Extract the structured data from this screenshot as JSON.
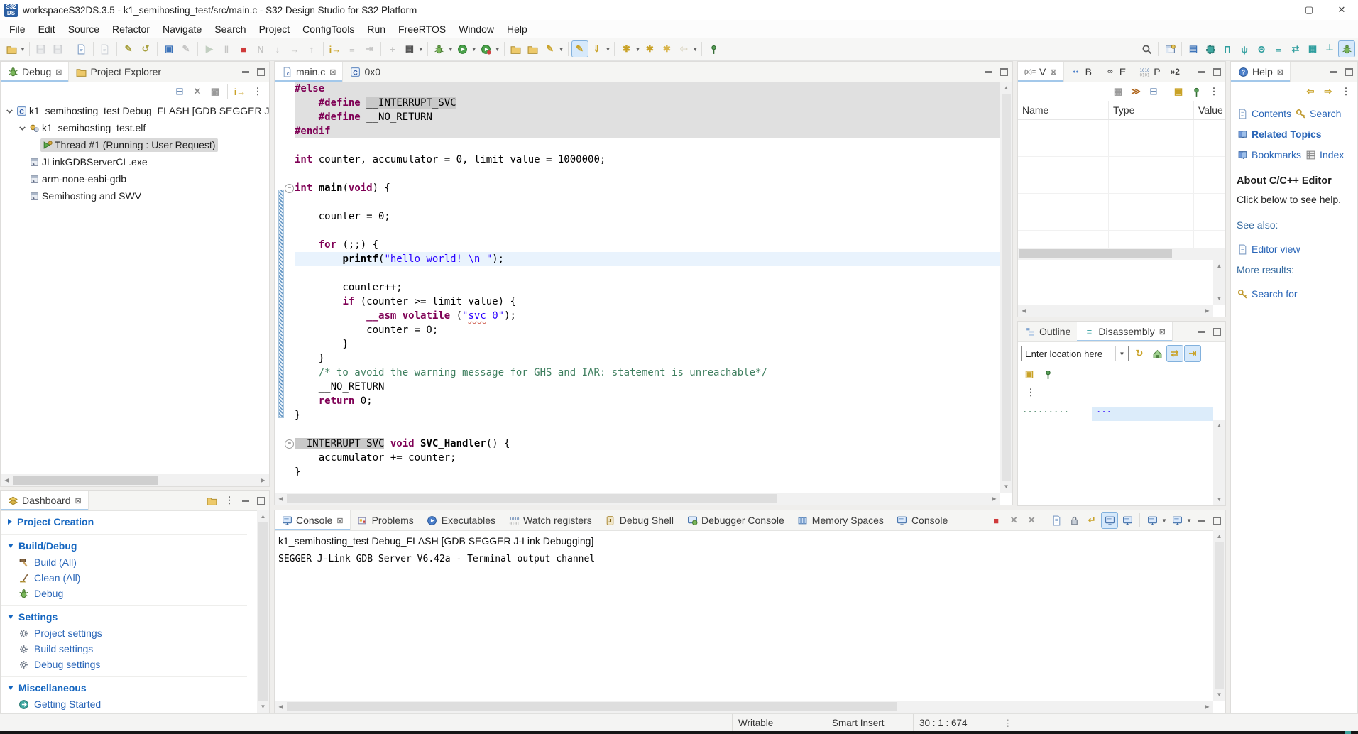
{
  "window": {
    "title": "workspaceS32DS.3.5 - k1_semihosting_test/src/main.c - S32 Design Studio for S32 Platform",
    "app_badge": "S32 DS",
    "controls": [
      {
        "name": "minimize",
        "glyph": "–"
      },
      {
        "name": "maximize",
        "glyph": "▢"
      },
      {
        "name": "close",
        "glyph": "✕"
      }
    ]
  },
  "menu": {
    "items": [
      "File",
      "Edit",
      "Source",
      "Refactor",
      "Navigate",
      "Search",
      "Project",
      "ConfigTools",
      "Run",
      "FreeRTOS",
      "Window",
      "Help"
    ]
  },
  "toolbar": {
    "left": [
      {
        "name": "new-wizard",
        "dropdown": true
      },
      "|",
      {
        "name": "save",
        "disabled": true
      },
      {
        "name": "save-all",
        "disabled": true
      },
      "|",
      {
        "name": "build"
      },
      "|",
      {
        "name": "new-file",
        "disabled": true
      },
      "|",
      {
        "name": "edit-config"
      },
      {
        "name": "revert"
      },
      "|",
      {
        "name": "open-element"
      },
      {
        "name": "pencil",
        "disabled": true
      },
      "|",
      {
        "name": "resume",
        "disabled": true
      },
      {
        "name": "suspend",
        "disabled": true
      },
      {
        "name": "stop"
      },
      {
        "name": "disconnect",
        "disabled": true
      },
      {
        "name": "step-into",
        "disabled": true
      },
      {
        "name": "step-over",
        "disabled": true
      },
      {
        "name": "step-return",
        "disabled": true
      },
      "|",
      {
        "name": "instruction-stepping"
      },
      {
        "name": "show-execution",
        "disabled": true
      },
      {
        "name": "drop-to-frame",
        "disabled": true
      },
      "|",
      {
        "name": "profile",
        "disabled": true
      },
      {
        "name": "memory",
        "dropdown": true
      },
      "|",
      {
        "name": "debug",
        "dropdown": true
      },
      {
        "name": "run",
        "dropdown": true
      },
      {
        "name": "external-tools",
        "dropdown": true
      },
      "|",
      {
        "name": "open-type"
      },
      {
        "name": "open-resource"
      },
      {
        "name": "mark-pen",
        "dropdown": true
      },
      "|",
      {
        "name": "toggle-mark-occurrences",
        "active": true
      },
      {
        "name": "show-selected",
        "dropdown": true
      },
      "|",
      {
        "name": "annotations",
        "dropdown": true
      },
      {
        "name": "new-task"
      },
      {
        "name": "new-bookmark"
      },
      {
        "name": "back",
        "disabled": true,
        "dropdown": true
      },
      "|",
      {
        "name": "pin-editor"
      }
    ],
    "right": [
      {
        "name": "search"
      },
      "|",
      {
        "name": "open-perspective"
      },
      "|",
      {
        "name": "ct-ivt"
      },
      {
        "name": "ct-chip"
      },
      {
        "name": "ct-pins"
      },
      {
        "name": "ct-peripherals"
      },
      {
        "name": "ct-clocks"
      },
      {
        "name": "ct-memory"
      },
      {
        "name": "ct-swap"
      },
      {
        "name": "ct-board"
      },
      {
        "name": "ct-probe"
      },
      {
        "name": "debug-perspective",
        "active": true
      }
    ]
  },
  "debug": {
    "tabs": [
      {
        "label": "Debug",
        "icon": "bug",
        "active": true,
        "closable": true
      },
      {
        "label": "Project Explorer",
        "icon": "folder"
      }
    ],
    "toolbar": [
      "collapse-all",
      "remove-terminated",
      "grid",
      "|",
      "instruction-stepping",
      "view-menu"
    ],
    "tree": [
      {
        "depth": 0,
        "expander": true,
        "icon": "c-config",
        "label": "k1_semihosting_test Debug_FLASH [GDB SEGGER J"
      },
      {
        "depth": 1,
        "expander": true,
        "icon": "gears",
        "label": "k1_semihosting_test.elf"
      },
      {
        "depth": 2,
        "expander": false,
        "icon": "thread",
        "label": "Thread #1 (Running : User Request)",
        "selected": true
      },
      {
        "depth": 1,
        "expander": false,
        "icon": "process",
        "label": "JLinkGDBServerCL.exe"
      },
      {
        "depth": 1,
        "expander": false,
        "icon": "process",
        "label": "arm-none-eabi-gdb"
      },
      {
        "depth": 1,
        "expander": false,
        "icon": "process",
        "label": "Semihosting and SWV"
      }
    ]
  },
  "dashboard": {
    "tab": {
      "label": "Dashboard",
      "icon": "dashboard",
      "closable": true
    },
    "toolbar": [
      "folder-edit",
      "view-menu"
    ],
    "sections": [
      {
        "label": "Project Creation",
        "collapsed": true,
        "items": []
      },
      {
        "label": "Build/Debug",
        "collapsed": false,
        "items": [
          {
            "icon": "hammer",
            "label": "Build  (All)"
          },
          {
            "icon": "broom",
            "label": "Clean  (All)"
          },
          {
            "icon": "bug",
            "label": "Debug"
          }
        ]
      },
      {
        "label": "Settings",
        "collapsed": false,
        "items": [
          {
            "icon": "gear",
            "label": "Project settings"
          },
          {
            "icon": "gear",
            "label": "Build settings"
          },
          {
            "icon": "gear",
            "label": "Debug settings"
          }
        ]
      },
      {
        "label": "Miscellaneous",
        "collapsed": false,
        "items": [
          {
            "icon": "go",
            "label": "Getting Started"
          }
        ]
      }
    ]
  },
  "editor": {
    "tabs": [
      {
        "label": "main.c",
        "icon": "c-file",
        "active": true,
        "closable": true
      },
      {
        "label": "0x0",
        "icon": "c-square"
      }
    ],
    "range_bar": {
      "from": 8,
      "to": 24
    },
    "lines": [
      {
        "bg": "inactive",
        "segs": [
          [
            "k",
            "#else"
          ]
        ]
      },
      {
        "bg": "inactive",
        "segs": [
          [
            "t",
            "    "
          ],
          [
            "k",
            "#define"
          ],
          [
            "t",
            " "
          ],
          [
            "hl",
            "__INTERRUPT_SVC"
          ]
        ]
      },
      {
        "bg": "inactive",
        "segs": [
          [
            "t",
            "    "
          ],
          [
            "k",
            "#define"
          ],
          [
            "t",
            " __NO_RETURN"
          ]
        ]
      },
      {
        "bg": "inactive",
        "segs": [
          [
            "k",
            "#endif"
          ]
        ]
      },
      {
        "segs": []
      },
      {
        "segs": [
          [
            "k",
            "int"
          ],
          [
            "t",
            " counter, accumulator = 0, limit_value = 1000000;"
          ]
        ]
      },
      {
        "segs": []
      },
      {
        "fold": true,
        "segs": [
          [
            "k",
            "int"
          ],
          [
            "t",
            " "
          ],
          [
            "f",
            "main"
          ],
          [
            "t",
            "("
          ],
          [
            "k",
            "void"
          ],
          [
            "t",
            ") {"
          ]
        ]
      },
      {
        "segs": []
      },
      {
        "segs": [
          [
            "t",
            "    counter = 0;"
          ]
        ]
      },
      {
        "segs": []
      },
      {
        "segs": [
          [
            "t",
            "    "
          ],
          [
            "k",
            "for"
          ],
          [
            "t",
            " (;;) {"
          ]
        ]
      },
      {
        "bg": "current",
        "segs": [
          [
            "t",
            "        "
          ],
          [
            "f",
            "printf"
          ],
          [
            "t",
            "("
          ],
          [
            "s",
            "\"hello world! \\n \""
          ],
          [
            "t",
            ");"
          ]
        ]
      },
      {
        "segs": []
      },
      {
        "segs": [
          [
            "t",
            "        counter++;"
          ]
        ]
      },
      {
        "segs": [
          [
            "t",
            "        "
          ],
          [
            "k",
            "if"
          ],
          [
            "t",
            " (counter >= limit_value) {"
          ]
        ]
      },
      {
        "segs": [
          [
            "t",
            "            "
          ],
          [
            "k",
            "__asm"
          ],
          [
            "t",
            " "
          ],
          [
            "k",
            "volatile"
          ],
          [
            "t",
            " ("
          ],
          [
            "s",
            "\""
          ],
          [
            "sq",
            "svc"
          ],
          [
            "s",
            " 0\""
          ],
          [
            "t",
            ");"
          ]
        ]
      },
      {
        "segs": [
          [
            "t",
            "            counter = 0;"
          ]
        ]
      },
      {
        "segs": [
          [
            "t",
            "        }"
          ]
        ]
      },
      {
        "segs": [
          [
            "t",
            "    }"
          ]
        ]
      },
      {
        "segs": [
          [
            "t",
            "    "
          ],
          [
            "c",
            "/* to avoid the warning message for GHS and IAR: statement is unreachable*/"
          ]
        ]
      },
      {
        "segs": [
          [
            "t",
            "    __NO_RETURN"
          ]
        ]
      },
      {
        "segs": [
          [
            "t",
            "    "
          ],
          [
            "k",
            "return"
          ],
          [
            "t",
            " 0;"
          ]
        ]
      },
      {
        "segs": [
          [
            "t",
            "}"
          ]
        ]
      },
      {
        "segs": []
      },
      {
        "fold": true,
        "segs": [
          [
            "hl",
            "__INTERRUPT_SVC"
          ],
          [
            "t",
            " "
          ],
          [
            "k",
            "void"
          ],
          [
            "t",
            " "
          ],
          [
            "f",
            "SVC_Handler"
          ],
          [
            "t",
            "() {"
          ]
        ]
      },
      {
        "segs": [
          [
            "t",
            "    accumulator += counter;"
          ]
        ]
      },
      {
        "segs": [
          [
            "t",
            "}"
          ]
        ]
      }
    ]
  },
  "variables": {
    "tabs": [
      {
        "label": "V",
        "icon": "variables",
        "active": true,
        "closable": true
      },
      {
        "label": "B",
        "icon": "breakpoints"
      },
      {
        "label": "E",
        "icon": "expressions"
      },
      {
        "label": "P",
        "icon": "peripherals"
      }
    ],
    "overflow": "»2",
    "toolbar": [
      "show-columns",
      "logical-structure",
      "collapse-all",
      "|",
      "new-view",
      "pin-view",
      "view-menu"
    ],
    "columns": [
      "Name",
      "Type",
      "Value"
    ],
    "empty_rows": 7
  },
  "outline": {
    "tabs": [
      {
        "label": "Outline",
        "icon": "outline"
      },
      {
        "label": "Disassembly",
        "icon": "disassembly",
        "active": true,
        "closable": true
      }
    ],
    "location": {
      "value": "Enter location here"
    },
    "toolbar": [
      "refresh",
      "home",
      "follow-a",
      "follow-b"
    ],
    "toolbar2": [
      "new-view",
      "pin-view"
    ],
    "toolbar3": [
      "view-menu"
    ],
    "dots_left": "· · · · · · · · ·",
    "dots_right": "· · ·"
  },
  "help": {
    "tab": {
      "label": "Help",
      "icon": "help",
      "closable": true
    },
    "toolbar": [
      "help-back",
      "help-forward",
      "view-menu"
    ],
    "links_row1": [
      {
        "icon": "doc",
        "label": "Contents"
      },
      {
        "icon": "key",
        "label": "Search"
      }
    ],
    "related": {
      "icon": "book",
      "label": "Related Topics"
    },
    "links_row2": [
      {
        "icon": "book",
        "label": "Bookmarks"
      },
      {
        "icon": "index",
        "label": "Index"
      }
    ],
    "about_title": "About C/C++ Editor",
    "about_text": "Click below to see help.",
    "see_also": "See also:",
    "editor_view_link": {
      "icon": "doc",
      "label": "Editor view"
    },
    "more_results": "More results:",
    "search_for_link": {
      "icon": "key",
      "label": "Search for"
    }
  },
  "console": {
    "tabs": [
      {
        "label": "Console",
        "icon": "console",
        "active": true,
        "closable": true
      },
      {
        "label": "Problems",
        "icon": "problems"
      },
      {
        "label": "Executables",
        "icon": "executables"
      },
      {
        "label": "Watch registers",
        "icon": "registers"
      },
      {
        "label": "Debug Shell",
        "icon": "debug-shell"
      },
      {
        "label": "Debugger Console",
        "icon": "debugger-console"
      },
      {
        "label": "Memory Spaces",
        "icon": "memory-spaces"
      },
      {
        "label": "Console",
        "icon": "console"
      }
    ],
    "toolbar": [
      "terminate",
      "remove-launch",
      "remove-all",
      "|",
      "clear-console",
      "scroll-lock",
      "word-wrap",
      {
        "name": "pin-console",
        "active": true
      },
      "show-on-output",
      "|",
      {
        "name": "display-selected",
        "dropdown": true
      },
      {
        "name": "open-console",
        "dropdown": true
      }
    ],
    "header": "k1_semihosting_test Debug_FLASH [GDB SEGGER J-Link Debugging]",
    "output": "SEGGER J-Link GDB Server V6.42a - Terminal output channel"
  },
  "status": {
    "writable": "Writable",
    "insert_mode": "Smart Insert",
    "position": "30 : 1 : 674"
  }
}
